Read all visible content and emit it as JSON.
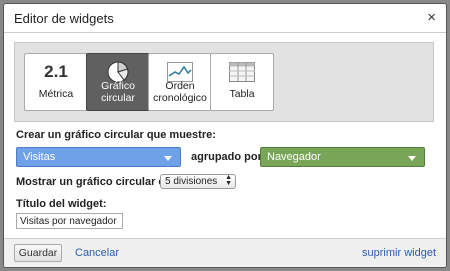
{
  "dialog": {
    "title": "Editor de widgets",
    "close_symbol": "×"
  },
  "tabs": [
    {
      "label": "Métrica",
      "icon": "metric-icon",
      "icon_text": "2.1",
      "active": false
    },
    {
      "label": "Gráfico circular",
      "icon": "pie-chart-icon",
      "active": true
    },
    {
      "label": "Orden cronológico",
      "icon": "timeline-icon",
      "active": false
    },
    {
      "label": "Tabla",
      "icon": "table-icon",
      "active": false
    }
  ],
  "form": {
    "create_label": "Crear un gráfico circular que muestre:",
    "metric_select": "Visitas",
    "grouped_by_label": "agrupado por",
    "dimension_select": "Navegador",
    "show_label": "Mostrar un gráfico circular con",
    "slices_select": "5 divisiones",
    "widget_title_label": "Título del widget:",
    "widget_title_value": "Visitas por navegador"
  },
  "footer": {
    "save": "Guardar",
    "cancel": "Cancelar",
    "delete": "suprimir widget"
  },
  "colors": {
    "active_tab": "#606060",
    "metric_select": "#6fa1e8",
    "dimension_select": "#78a557",
    "link": "#2a5db0"
  }
}
